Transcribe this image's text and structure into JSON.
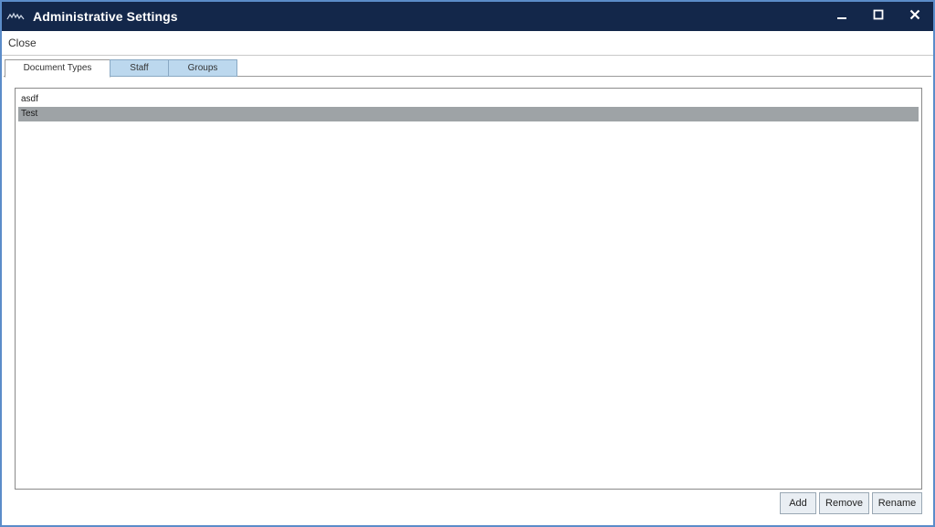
{
  "window": {
    "title": "Administrative Settings",
    "icon": "app-logo-icon",
    "controls": {
      "minimize_icon": "minimize-icon",
      "maximize_icon": "maximize-icon",
      "close_icon": "close-icon"
    },
    "colors": {
      "titlebar": "#13274a",
      "border": "#5b8cc9"
    }
  },
  "menu": {
    "close_label": "Close"
  },
  "tabs": [
    {
      "label": "Document Types",
      "active": true
    },
    {
      "label": "Staff",
      "active": false
    },
    {
      "label": "Groups",
      "active": false
    }
  ],
  "list": {
    "items": [
      {
        "label": "asdf",
        "selected": false
      },
      {
        "label": "Test",
        "selected": true
      }
    ],
    "selected_color": "#9ea3a6"
  },
  "actions": {
    "add_label": "Add",
    "remove_label": "Remove",
    "rename_label": "Rename"
  }
}
